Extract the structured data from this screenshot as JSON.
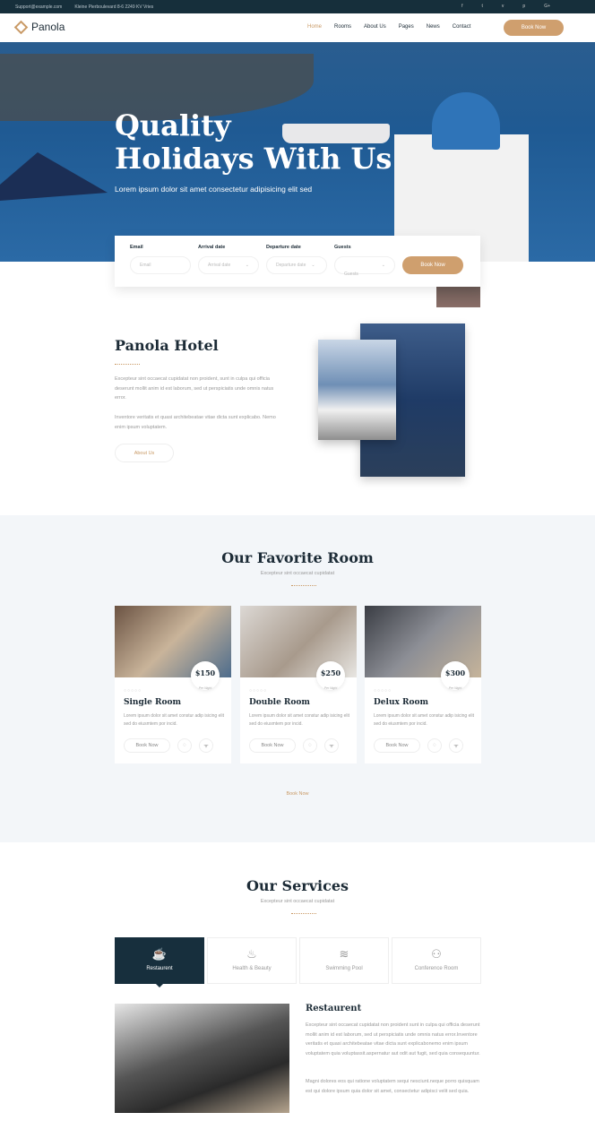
{
  "topbar": {
    "email": "Support@example.com",
    "address": "Kleine Pierboulevard 8-6 2249 KV Vries",
    "social": [
      "f",
      "t",
      "v",
      "p",
      "G+"
    ]
  },
  "nav": {
    "logo": "Panola",
    "items": [
      "Home",
      "Rooms",
      "About Us",
      "Pages",
      "News",
      "Contact"
    ],
    "active": "Home",
    "book": "Book Now"
  },
  "hero": {
    "title_line1": "Quality",
    "title_line2": "Holidays With Us",
    "subtitle": "Lorem ipsum dolor sit amet consectetur adipisicing elit sed"
  },
  "booking": {
    "email_label": "Email",
    "email_placeholder": "Email",
    "arrival_label": "Arrival date",
    "arrival_placeholder": "Arrival date",
    "departure_label": "Departure date",
    "departure_placeholder": "Departure date",
    "guests_label": "Guests",
    "guests_placeholder": "Guests",
    "button": "Book Now"
  },
  "about": {
    "title": "Panola Hotel",
    "p1": "Excepteur sint occaecat cupidatat non proident, sunt in culpa qui officia deserunt mollit anim id est laborum, sed ut perspiciatis unde omnis natus error.",
    "p2": "Inventore veritatis et quasi architebeatae vitae dicta sunt explicabo. Nemo enim ipsum voluptatem.",
    "button": "About Us"
  },
  "rooms": {
    "title": "Our Favorite Room",
    "subtitle": "Excepteur sint occaecat cupidatat",
    "more": "Book Now",
    "items": [
      {
        "name": "Single Room",
        "price": "$150",
        "per": "Per Night",
        "desc": "Lorem ipsum dolor sit amet constur adip isicing elit sed do eiusmtem por incid.",
        "button": "Book Now"
      },
      {
        "name": "Double Room",
        "price": "$250",
        "per": "Per Night",
        "desc": "Lorem ipsum dolor sit amet constur adip isicing elit sed do eiusmtem por incid.",
        "button": "Book Now"
      },
      {
        "name": "Delux Room",
        "price": "$300",
        "per": "Per Night",
        "desc": "Lorem ipsum dolor sit amet constur adip isicing elit sed do eiusmtem por incid.",
        "button": "Book Now"
      }
    ]
  },
  "services": {
    "title": "Our Services",
    "subtitle": "Excepteur sint occaecat cupidatat",
    "tabs": [
      {
        "label": "Restaurent",
        "icon": "coffee-icon"
      },
      {
        "label": "Health & Beauty",
        "icon": "spa-icon"
      },
      {
        "label": "Swimming Pool",
        "icon": "pool-icon"
      },
      {
        "label": "Conference Room",
        "icon": "conference-icon"
      }
    ],
    "detail_title": "Restaurent",
    "detail_p1": "Excepteur sint occaecat cupidatat non proident sunt in culpa qui officia deserunt mollit anim id est laborum, sed ut perspiciatis unde omnis natus error.Inventore veritatis et quasi architebeatae vitae dicta sunt explicabonemo enim ipsum voluptatem quia voluptassit.aspernatur aut odit aut fugit, sed quia consequuntur.",
    "detail_p2": "Magni dolores eos qui ratione voluptatem sequi nesciunt.neque porro quisquam est qui dolore ipsum quia dolor sit amet, consectetur adipisci velit sed quia."
  },
  "colors": {
    "dark": "#162f3b",
    "gold": "#cf9f6e"
  }
}
